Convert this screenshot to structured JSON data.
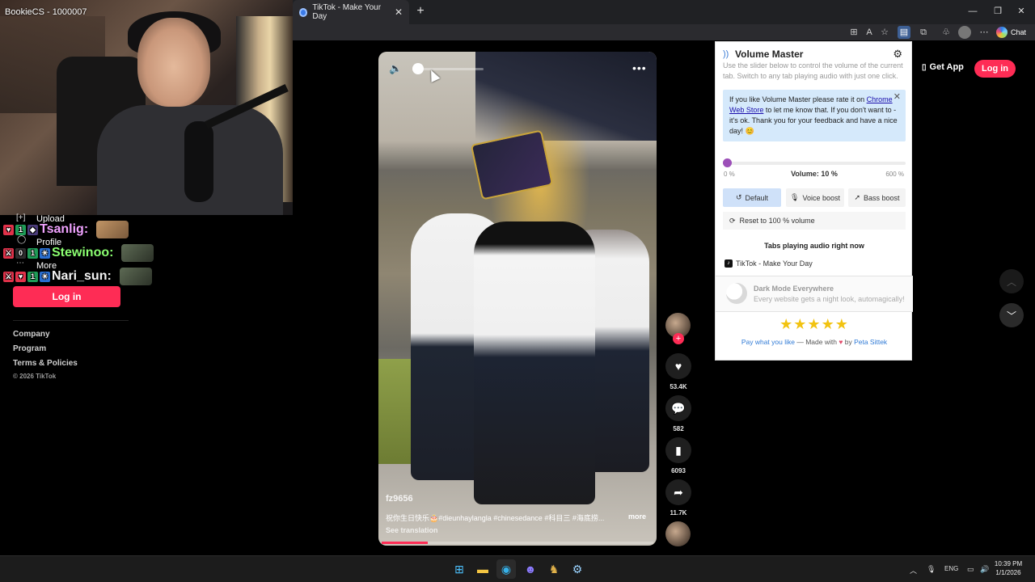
{
  "stream": {
    "streamer_label": "BookieCS - 1000007"
  },
  "chat": [
    {
      "name": "Tsanlig:",
      "color": "#f0a2ff"
    },
    {
      "name": "Stewinoo:",
      "color": "#8bff71"
    },
    {
      "name": "Nari_sun:",
      "color": "#f3f3f3"
    }
  ],
  "tiktok_sidebar": {
    "items": [
      "Upload",
      "Profile",
      "More"
    ],
    "login_label": "Log in",
    "footer_links": [
      "Company",
      "Program",
      "Terms & Policies"
    ],
    "copyright": "© 2026 TikTok"
  },
  "browser": {
    "tab_title": "TikTok - Make Your Day",
    "chat_label": "Chat"
  },
  "video": {
    "author": "fz9656",
    "caption": "祝你生日快乐🎂#dieunhaylangla #chinesedance #科目三 #海底捞...",
    "more_label": "more",
    "translate_label": "See translation",
    "volume_level": 0.05,
    "progress": 0.17
  },
  "actions": {
    "likes": "53.4K",
    "comments": "582",
    "saves": "6093",
    "shares": "11.7K"
  },
  "header": {
    "get_app_label": "Get App",
    "login_label": "Log in"
  },
  "volume_master": {
    "title": "Volume Master",
    "description": "Use the slider below to control the volume of the current tab. Switch to any tab playing audio with just one click.",
    "rate_text_1": "If you like Volume Master please rate it on",
    "rate_link": "Chrome Web Store",
    "rate_text_2": "to let me know that. If you don't want to - it's ok. Thank you for your feedback and have a nice day! 😊",
    "min_label": "0 %",
    "max_label": "600 %",
    "volume_label": "Volume: 10 %",
    "volume_percent": 10,
    "volume_max": 600,
    "btn_default": "Default",
    "btn_voice": "Voice boost",
    "btn_bass": "Bass boost",
    "reset_label": "Reset to 100 % volume",
    "tabs_title": "Tabs playing audio right now",
    "tab_item": "TikTok - Make Your Day",
    "dark_title": "Dark Mode Everywhere",
    "dark_sub": "Every website gets a night look, automagically!",
    "stars": "★★★★★",
    "footer_pay": "Pay what you like",
    "footer_mid": " — Made with ",
    "footer_heart": "♥",
    "footer_by": " by ",
    "footer_author": "Peta Sittek",
    "accent": "#9c4fb8"
  },
  "taskbar": {
    "lang": "ENG",
    "time": "10:39 PM",
    "date": "1/1/2026"
  }
}
